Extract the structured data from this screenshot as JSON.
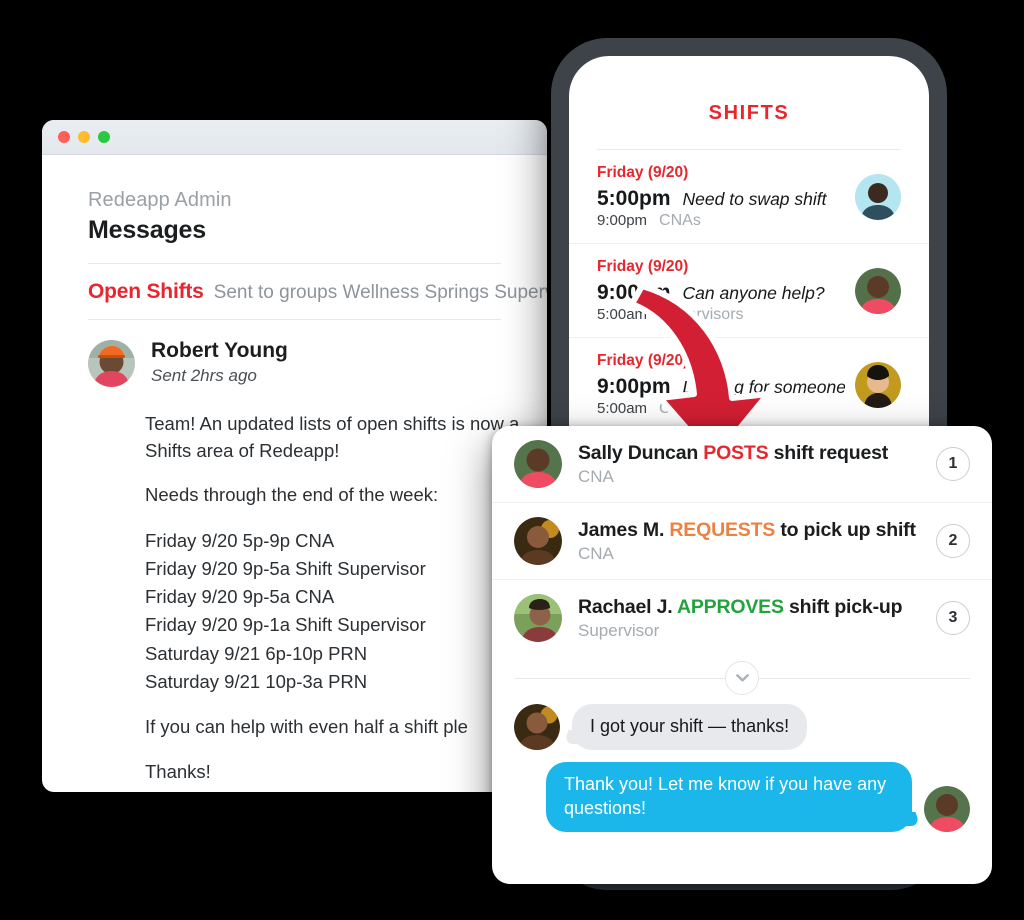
{
  "desktop": {
    "traffic_lights": [
      "close",
      "minimize",
      "zoom"
    ],
    "breadcrumb": "Redeapp Admin",
    "page_title": "Messages",
    "subject": "Open Shifts",
    "sent_to": "Sent to groups Wellness Springs Supervis",
    "sender": {
      "name": "Robert Young",
      "sent": "Sent 2hrs ago",
      "avatar": "robert-young-avatar"
    },
    "body": {
      "intro": "Team! An updated lists of open shifts is now a",
      "intro2": "Shifts area of Redeapp!",
      "needs_label": "Needs through the end of the week:",
      "shifts": [
        "Friday 9/20 5p-9p CNA",
        "Friday 9/20 9p-5a Shift Supervisor",
        "Friday 9/20 9p-5a CNA",
        "Friday 9/20 9p-1a Shift Supervisor",
        "Saturday 9/21 6p-10p PRN",
        "Saturday 9/21 10p-3a PRN"
      ],
      "closing": "If you can help with even half a shift ple",
      "thanks": "Thanks!"
    }
  },
  "phone": {
    "screen_title": "SHIFTS",
    "shifts": [
      {
        "day": "Friday (9/20)",
        "start": "5:00pm",
        "end": "9:00pm",
        "note": "Need to swap shift",
        "group": "CNAs",
        "avatar": "cna-requester-avatar"
      },
      {
        "day": "Friday (9/20)",
        "start": "9:00pm",
        "end": "5:00am",
        "note": "Can anyone help?",
        "group": "Supervisors",
        "avatar": "sally-duncan-avatar"
      },
      {
        "day": "Friday (9/20)",
        "start": "9:00pm",
        "end": "5:00am",
        "note": "Looking for someone to be...",
        "group": "CNAs",
        "avatar": "third-poster-avatar"
      }
    ]
  },
  "flow_card": {
    "steps": [
      {
        "number": "1",
        "name": "Sally Duncan",
        "keyword": "POSTS",
        "keyword_color": "#e8262e",
        "action_suffix": "shift request",
        "role": "CNA",
        "avatar": "sally-duncan-avatar"
      },
      {
        "number": "2",
        "name": "James M.",
        "keyword": "REQUESTS",
        "keyword_color": "#ed8042",
        "action_suffix": "to pick up shift",
        "role": "CNA",
        "avatar": "james-m-avatar"
      },
      {
        "number": "3",
        "name": "Rachael J.",
        "keyword": "APPROVES",
        "keyword_color": "#23a33e",
        "action_suffix": "shift pick-up",
        "role": "Supervisor",
        "avatar": "rachael-j-avatar"
      }
    ],
    "expand_icon": "chevron-down-icon",
    "chat": [
      {
        "side": "left",
        "text": "I got your shift — thanks!",
        "avatar": "james-m-avatar",
        "bubble_color": "#e7e9ec"
      },
      {
        "side": "right",
        "text": "Thank you! Let me know if you have any questions!",
        "avatar": "sally-duncan-avatar",
        "bubble_color": "#1bb7eb"
      }
    ]
  },
  "annotation": {
    "arrow": "red-curved-down-arrow",
    "arrow_color": "#d31f33"
  },
  "colors": {
    "background": "#000000",
    "brand_red": "#e8262e",
    "accent_orange": "#ed8042",
    "accent_green": "#23a33e",
    "chat_blue": "#1bb7eb",
    "phone_bezel": "#3d4349"
  }
}
